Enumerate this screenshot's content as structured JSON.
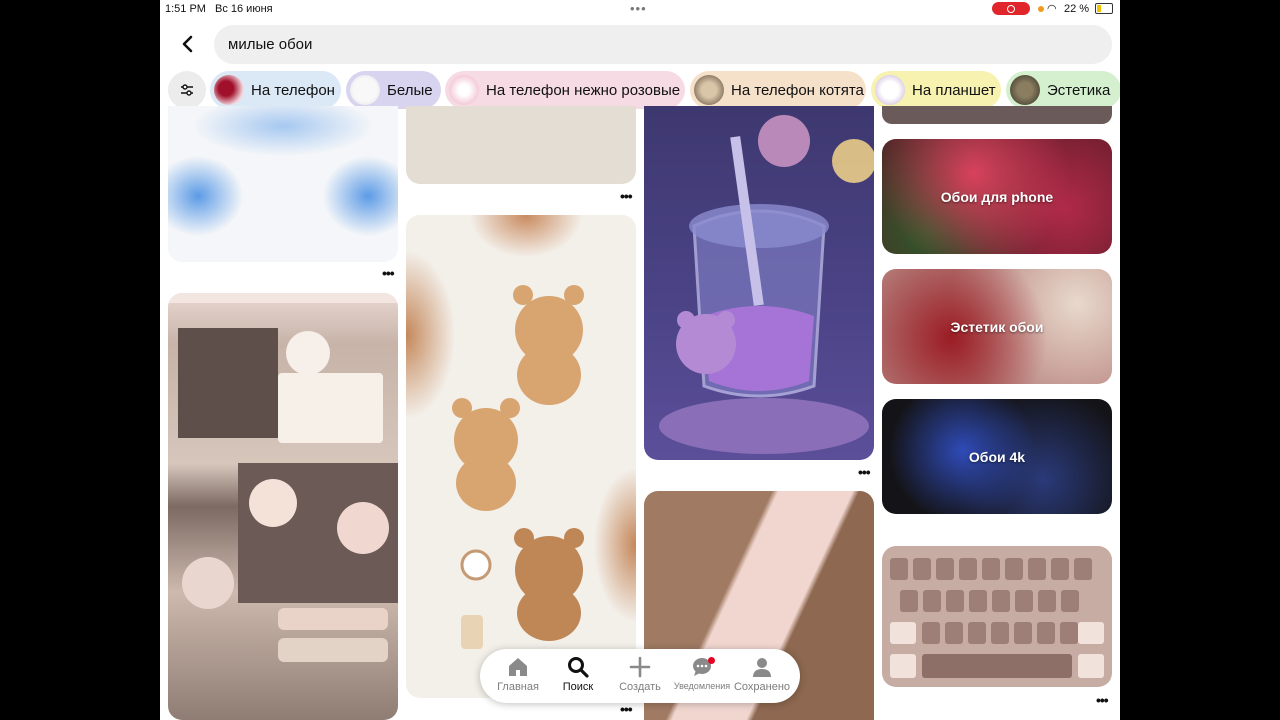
{
  "status": {
    "time": "1:51 PM",
    "date": "Вс 16 июня",
    "battery": "22 %"
  },
  "search": {
    "query": "милые обои"
  },
  "chips": [
    {
      "label": "На телефон",
      "bg": "#dbe8f5"
    },
    {
      "label": "Белые",
      "bg": "#d8d4f0"
    },
    {
      "label": "На телефон нежно розовые",
      "bg": "#f7dbe4"
    },
    {
      "label": "На телефон котята",
      "bg": "#f5e1c9"
    },
    {
      "label": "На планшет",
      "bg": "#f7f2b0"
    },
    {
      "label": "Эстетика",
      "bg": "#d4f0cf"
    }
  ],
  "boards": [
    {
      "title": "Обои для phone"
    },
    {
      "title": "Эстетик обои"
    },
    {
      "title": "Обои 4k"
    }
  ],
  "nav": {
    "home": "Главная",
    "search": "Поиск",
    "create": "Создать",
    "notifications": "Уведомления",
    "saved": "Сохранено"
  },
  "pin_menu_glyph": "•••"
}
